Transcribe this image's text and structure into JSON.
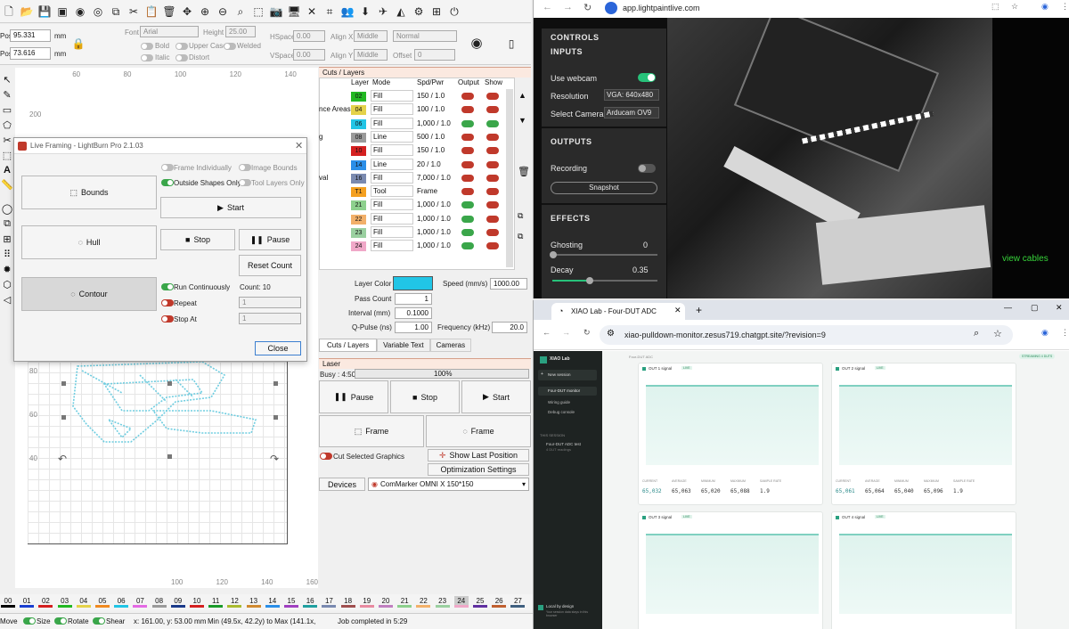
{
  "lightburn": {
    "pos_x": "95.331",
    "pos_y": "73.616",
    "unit": "mm",
    "font_label": "Font",
    "font_value": "Arial",
    "height_label": "Height",
    "height_value": "25.00",
    "bold": "Bold",
    "italic": "Italic",
    "upper_case": "Upper Case",
    "distort": "Distort",
    "welded": "Welded",
    "hspace_label": "HSpace",
    "hspace": "0.00",
    "vspace_label": "VSpace",
    "vspace": "0.00",
    "alignx_label": "Align X",
    "alignx": "Middle",
    "aligny_label": "Align Y",
    "aligny": "Middle",
    "normal": "Normal",
    "offset_label": "Offset",
    "offset": "0",
    "ruler_top": [
      "60",
      "80",
      "100",
      "120",
      "140"
    ],
    "ruler_left": [
      "200"
    ],
    "ruler_left_lower": [
      "80",
      "60",
      "40"
    ],
    "canvas_top_nums": [
      "60",
      "80",
      "100",
      "120",
      "140"
    ],
    "canvas_bottom_nums": [
      "100",
      "120",
      "140",
      "160"
    ]
  },
  "framing": {
    "title": "Live Framing - LightBurn Pro 2.1.03",
    "frame_individually": "Frame Individually",
    "image_bounds": "Image Bounds",
    "outside_shapes_only": "Outside Shapes Only",
    "tool_layers_only": "Tool Layers Only",
    "bounds": "Bounds",
    "start": "Start",
    "hull": "Hull",
    "stop": "Stop",
    "pause": "Pause",
    "reset_count": "Reset Count",
    "contour": "Contour",
    "run_continuously": "Run Continuously",
    "count": "Count: 10",
    "repeat": "Repeat",
    "repeat_val": "1",
    "stop_at": "Stop At",
    "stop_at_val": "1",
    "close": "Close"
  },
  "cuts": {
    "title": "Cuts / Layers",
    "headers": [
      "#",
      "Layer",
      "Mode",
      "Spd/Pwr",
      "Output",
      "Show"
    ],
    "left_frags": [
      "",
      "nce Areas",
      "",
      "g",
      "",
      "",
      "val",
      "",
      "",
      "",
      "",
      ""
    ],
    "rows": [
      {
        "num": "02",
        "color": "#23b823",
        "mode": "Fill",
        "sp": "150 / 1.0",
        "out": false,
        "show": false
      },
      {
        "num": "04",
        "color": "#e4d24a",
        "mode": "Fill",
        "sp": "100 / 1.0",
        "out": false,
        "show": false
      },
      {
        "num": "06",
        "color": "#21c5e6",
        "mode": "Fill",
        "sp": "1,000 / 1.0",
        "out": true,
        "show": true
      },
      {
        "num": "08",
        "color": "#9a9a9a",
        "mode": "Line",
        "sp": "500 / 1.0",
        "out": false,
        "show": false
      },
      {
        "num": "10",
        "color": "#d42020",
        "mode": "Fill",
        "sp": "150 / 1.0",
        "out": false,
        "show": false
      },
      {
        "num": "14",
        "color": "#2a8ee8",
        "mode": "Line",
        "sp": "20 / 1.0",
        "out": false,
        "show": false
      },
      {
        "num": "16",
        "color": "#7a8ab0",
        "mode": "Fill",
        "sp": "7,000 / 1.0",
        "out": false,
        "show": false
      },
      {
        "num": "T1",
        "color": "#f4a020",
        "mode": "Tool",
        "sp": "Frame",
        "out": false,
        "show": false
      },
      {
        "num": "21",
        "color": "#8dd08d",
        "mode": "Fill",
        "sp": "1,000 / 1.0",
        "out": true,
        "show": false
      },
      {
        "num": "22",
        "color": "#f2b06a",
        "mode": "Fill",
        "sp": "1,000 / 1.0",
        "out": true,
        "show": false
      },
      {
        "num": "23",
        "color": "#9ad0a0",
        "mode": "Fill",
        "sp": "1,000 / 1.0",
        "out": true,
        "show": false
      },
      {
        "num": "24",
        "color": "#f0a8c8",
        "mode": "Fill",
        "sp": "1,000 / 1.0",
        "out": true,
        "show": false
      }
    ],
    "layer_color": "Layer Color",
    "speed_label": "Speed (mm/s)",
    "speed": "1000.00",
    "pass_count_label": "Pass Count",
    "pass_count": "1",
    "interval_label": "Interval (mm)",
    "interval": "0.1000",
    "qpulse_label": "Q-Pulse (ns)",
    "qpulse": "1.00",
    "freq_label": "Frequency (kHz)",
    "freq": "20.0",
    "tabs": [
      "Cuts / Layers",
      "Variable Text",
      "Cameras"
    ]
  },
  "laser": {
    "title": "Laser",
    "busy": "Busy : 4:50",
    "progress_label": "100%",
    "progress": 1.0,
    "pause": "Pause",
    "stop": "Stop",
    "start": "Start",
    "frame1": "Frame",
    "frame2": "Frame",
    "cut_selected": "Cut Selected Graphics",
    "show_last": "Show Last Position",
    "opt_settings": "Optimization Settings",
    "devices": "Devices",
    "device": "ComMarker OMNI X 150*150"
  },
  "palette": [
    "00",
    "01",
    "02",
    "03",
    "04",
    "05",
    "06",
    "07",
    "08",
    "09",
    "10",
    "11",
    "12",
    "13",
    "14",
    "15",
    "16",
    "17",
    "18",
    "19",
    "20",
    "21",
    "22",
    "23",
    "24",
    "25",
    "26",
    "27"
  ],
  "palette_colors": [
    "#000000",
    "#1a3fd0",
    "#d42020",
    "#23b823",
    "#e4d24a",
    "#f08a20",
    "#21c5e6",
    "#e46ae4",
    "#9a9a9a",
    "#1a3a8a",
    "#d42020",
    "#1a9a2a",
    "#aabb30",
    "#d08a30",
    "#2a8ee8",
    "#a040c0",
    "#20a0a0",
    "#7a8ab0",
    "#a05050",
    "#e88aa0",
    "#c080c0",
    "#8dd08d",
    "#f2b06a",
    "#9ad0a0",
    "#f0a8c8",
    "#6030a0",
    "#c06030",
    "#406080"
  ],
  "status": {
    "move": "Move",
    "size": "Size",
    "rotate": "Rotate",
    "shear": "Shear",
    "coords": "x: 161.00, y: 53.00 mm",
    "minmax": "Min (49.5x, 42.2y) to Max (141.1x,",
    "job": "Job completed in 5:29"
  },
  "browser1": {
    "url": "app.lightpaintlive.com"
  },
  "lpl": {
    "controls": "CONTROLS",
    "inputs": "INPUTS",
    "use_webcam": "Use webcam",
    "resolution_label": "Resolution",
    "resolution": "VGA: 640x480",
    "select_camera_label": "Select Camera",
    "select_camera": "Arducam OV9",
    "outputs": "OUTPUTS",
    "recording": "Recording",
    "snapshot": "Snapshot",
    "effects": "EFFECTS",
    "ghosting_label": "Ghosting",
    "ghosting": "0",
    "decay_label": "Decay",
    "decay": "0.35",
    "decay_level": 0.35,
    "overlay": "view cables"
  },
  "browser2": {
    "tab_title": "XIAO Lab - Four-DUT ADC",
    "url": "xiao-pulldown-monitor.zesus719.chatgpt.site/?revision=9"
  },
  "xiao": {
    "brand": "XIAO Lab",
    "new_session": "New session",
    "nav": [
      "Four-DUT monitor",
      "Wiring guide",
      "Debug console"
    ],
    "section": "THIS SESSION",
    "session": "Four-DUT ADC test",
    "session_sub": "4 DUT readings",
    "local": "Local by design",
    "local_sub": "Your session data stays in this browser",
    "breadcrumb": "Four-DUT ADC",
    "badge": "STREAMING 4 DUTS",
    "cards": [
      {
        "title": "OUT 1 signal",
        "tag": "LIVE",
        "stats": [
          "65,032",
          "65,063",
          "65,020",
          "65,088",
          "1.9"
        ]
      },
      {
        "title": "OUT 2 signal",
        "tag": "LIVE",
        "stats": [
          "65,061",
          "65,064",
          "65,040",
          "65,096",
          "1.9"
        ]
      },
      {
        "title": "OUT 3 signal",
        "tag": "LIVE",
        "stats": []
      },
      {
        "title": "OUT 4 signal",
        "tag": "LIVE",
        "stats": []
      }
    ],
    "stat_labels": [
      "CURRENT",
      "AVERAGE",
      "MINIMUM",
      "MAXIMUM",
      "SAMPLE RATE"
    ]
  }
}
